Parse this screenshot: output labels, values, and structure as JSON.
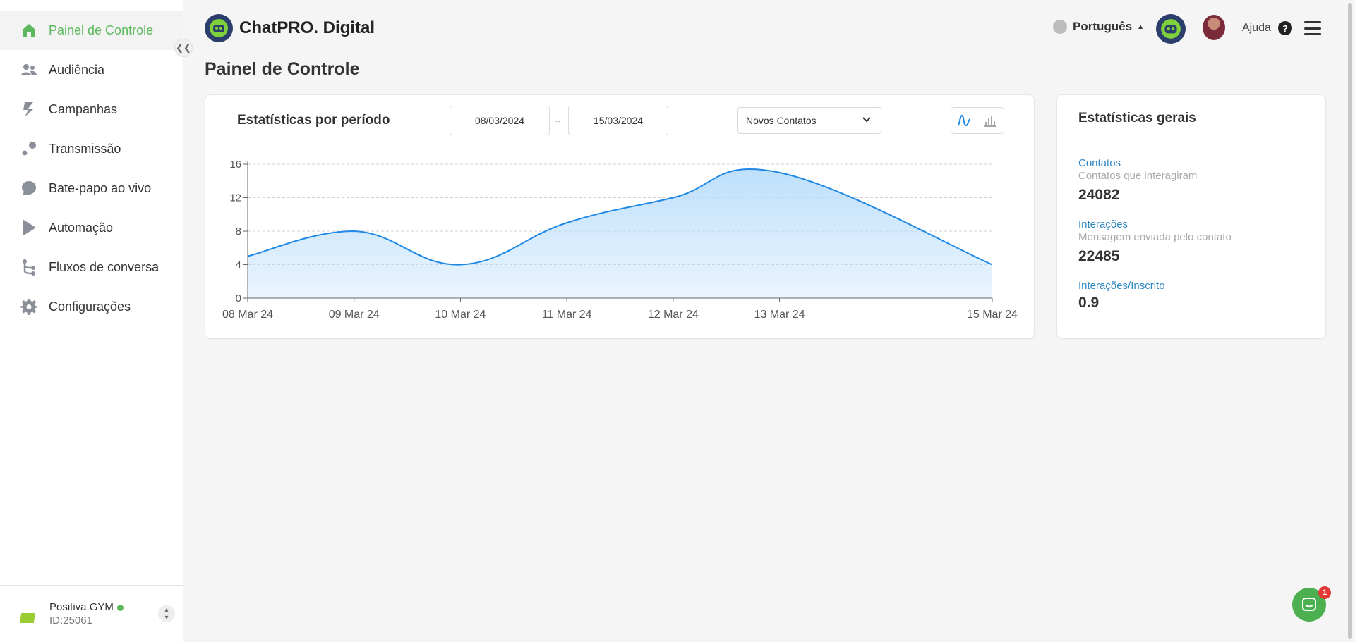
{
  "app": {
    "name": "ChatPRO. Digital"
  },
  "sidebar": {
    "items": [
      {
        "label": "Painel de Controle",
        "icon": "home-icon",
        "active": true
      },
      {
        "label": "Audiência",
        "icon": "users-icon"
      },
      {
        "label": "Campanhas",
        "icon": "campaign-icon"
      },
      {
        "label": "Transmissão",
        "icon": "broadcast-icon"
      },
      {
        "label": "Bate-papo ao vivo",
        "icon": "chat-icon"
      },
      {
        "label": "Automação",
        "icon": "automation-icon"
      },
      {
        "label": "Fluxos de conversa",
        "icon": "flow-icon"
      },
      {
        "label": "Configurações",
        "icon": "gear-icon"
      }
    ],
    "account": {
      "name": "Positiva GYM",
      "id": "ID:25061",
      "status": "online"
    }
  },
  "header": {
    "language": "Português",
    "help_label": "Ajuda"
  },
  "page": {
    "title": "Painel de Controle"
  },
  "stats_card": {
    "title": "Estatísticas por período",
    "date_from": "08/03/2024",
    "date_to": "15/03/2024",
    "metric": "Novos Contatos",
    "chart_mode": "line"
  },
  "general": {
    "title": "Estatísticas gerais",
    "stats": [
      {
        "label": "Contatos",
        "desc": "Contatos que interagiram",
        "value": "24082"
      },
      {
        "label": "Interações",
        "desc": "Mensagem enviada pelo contato",
        "value": "22485"
      },
      {
        "label": "Interações/Inscrito",
        "desc": "",
        "value": "0.9"
      }
    ]
  },
  "chat_widget": {
    "badge": "1"
  },
  "colors": {
    "accent": "#5cb85c",
    "chart_line": "#1e88e5",
    "chart_fill": "#bbdefb",
    "link": "#2e86c1"
  },
  "chart_data": {
    "type": "area",
    "x": [
      "08 Mar 24",
      "09 Mar 24",
      "10 Mar 24",
      "11 Mar 24",
      "12 Mar 24",
      "13 Mar 24",
      "15 Mar 24"
    ],
    "x_dates": [
      "2024-03-08",
      "2024-03-09",
      "2024-03-10",
      "2024-03-11",
      "2024-03-12",
      "2024-03-13",
      "2024-03-15"
    ],
    "values": [
      5,
      8,
      4,
      9,
      12,
      15,
      4
    ],
    "y_ticks": [
      0,
      4,
      8,
      12,
      16
    ],
    "ylim": [
      0,
      16
    ],
    "grid": true,
    "legend": "none",
    "title": "",
    "xlabel": "",
    "ylabel": ""
  }
}
